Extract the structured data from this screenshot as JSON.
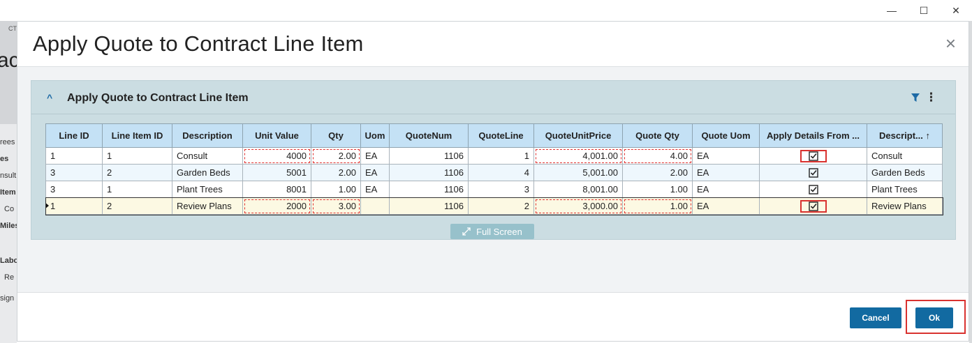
{
  "window": {
    "minimize_glyph": "—",
    "maximize_glyph": "☐",
    "close_glyph": "✕"
  },
  "background": {
    "small": "CT",
    "big": "ac",
    "items": [
      "rees",
      "es",
      "nsult",
      "Item",
      "Co",
      "Miles",
      "Labo",
      "Re",
      "sign"
    ]
  },
  "modal": {
    "title": "Apply Quote to Contract Line Item",
    "close_glyph": "×",
    "panel": {
      "title": "Apply Quote to Contract Line Item",
      "collapse_glyph": "^",
      "more_glyph": "⋮"
    },
    "grid": {
      "columns": [
        "Line ID",
        "Line Item ID",
        "Description",
        "Unit Value",
        "Qty",
        "Uom",
        "QuoteNum",
        "QuoteLine",
        "QuoteUnitPrice",
        "Quote Qty",
        "Quote Uom",
        "Apply Details From ...",
        "Descript... ↑"
      ],
      "rows": [
        [
          "1",
          "1",
          "Consult",
          "4000",
          "2.00",
          "EA",
          "1106",
          "1",
          "4,001.00",
          "4.00",
          "EA",
          "",
          "Consult"
        ],
        [
          "3",
          "2",
          "Garden Beds",
          "5001",
          "2.00",
          "EA",
          "1106",
          "4",
          "5,001.00",
          "2.00",
          "EA",
          "",
          "Garden Beds"
        ],
        [
          "3",
          "1",
          "Plant Trees",
          "8001",
          "1.00",
          "EA",
          "1106",
          "3",
          "8,001.00",
          "1.00",
          "EA",
          "",
          "Plant Trees"
        ],
        [
          "1",
          "2",
          "Review Plans",
          "2000",
          "3.00",
          "",
          "1106",
          "2",
          "3,000.00",
          "1.00",
          "EA",
          "",
          "Review Plans"
        ]
      ]
    },
    "full_screen_label": "Full Screen",
    "cancel_label": "Cancel",
    "ok_label": "Ok"
  },
  "colors": {
    "accent": "#126aa1",
    "header_bg": "#c4e1f5",
    "highlight": "#d9322f"
  }
}
